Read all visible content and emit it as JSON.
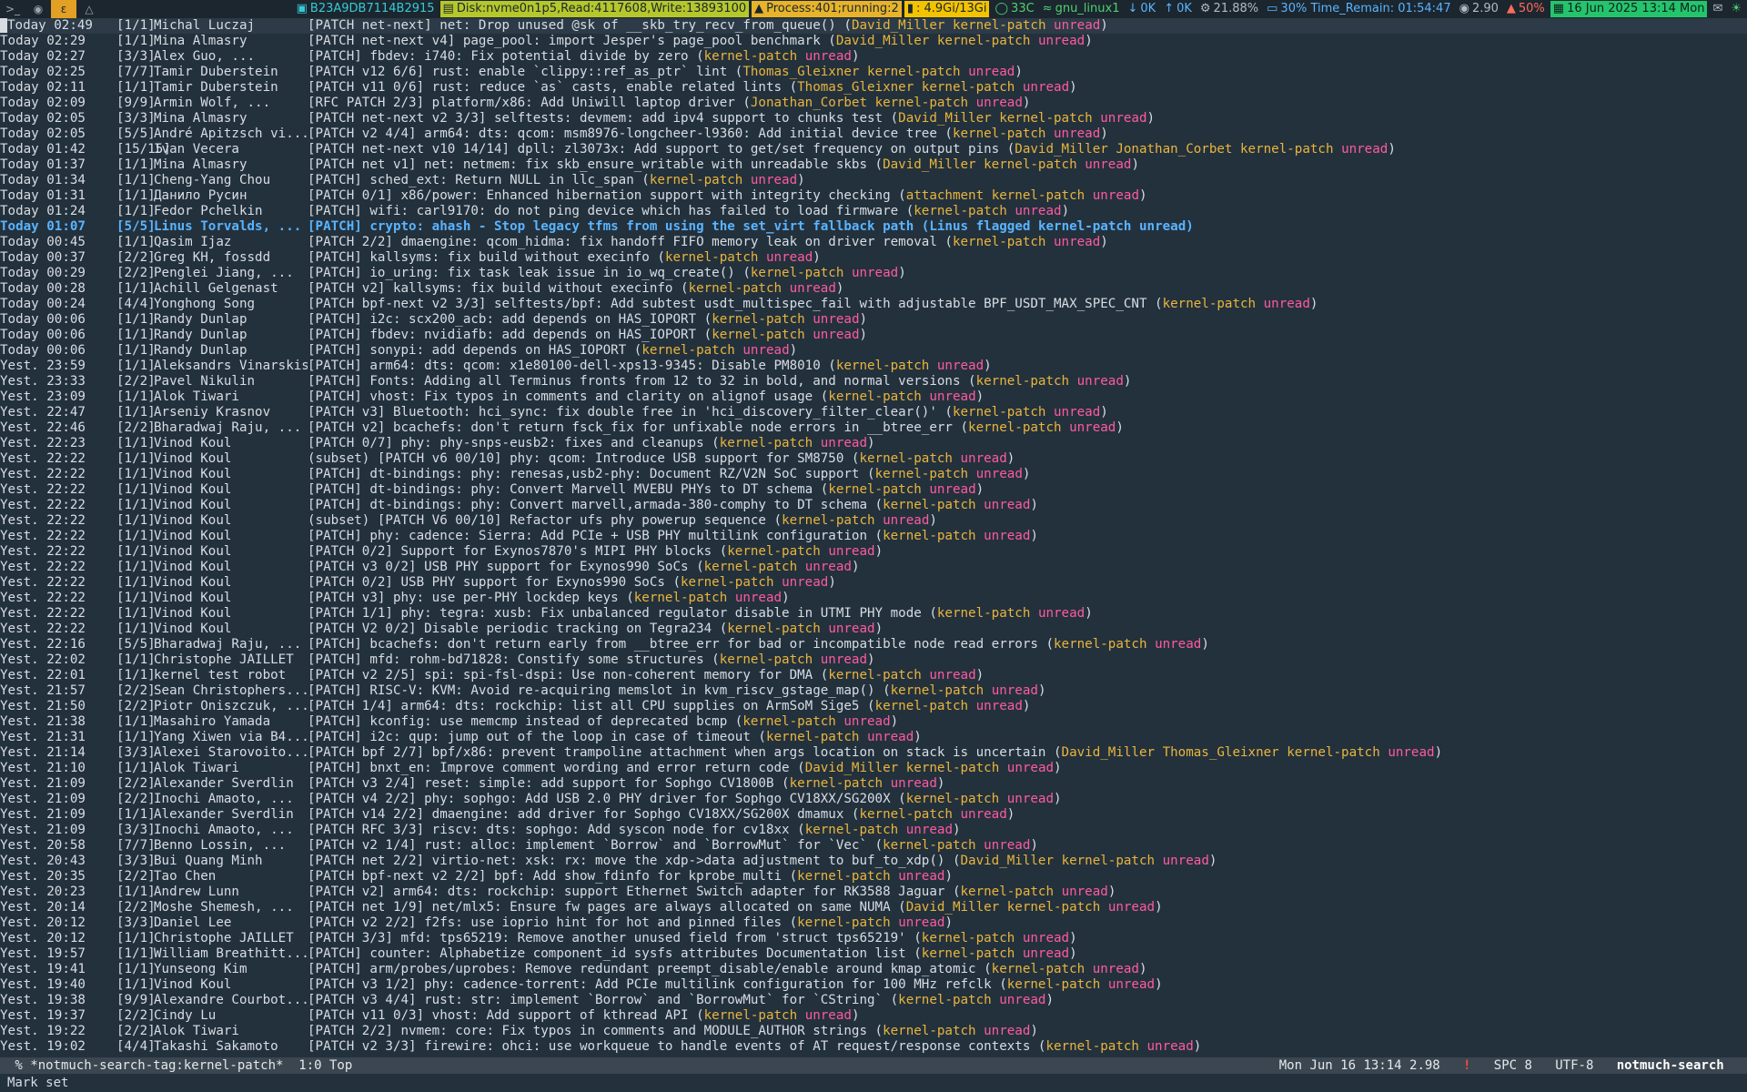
{
  "topbar": {
    "hostname": "B23A9DB7114B2915",
    "disk": "Disk:nvme0n1p5,Read:4117608,Write:13893100",
    "process": "Process:401;running:2",
    "mem": ": 4.9Gi/13Gi",
    "temp": "33C",
    "wifi": "gnu_linux1",
    "net_down": "0K",
    "net_up": "0K",
    "cpu": "21.88%",
    "battery": "30% Time_Remain: 01:54:47",
    "load": "2.90",
    "volume": "50%",
    "datetime": "16 Jun 2025 13:14 Mon"
  },
  "mail_list": [
    {
      "date": "Today 02:49",
      "count": "[1/1]",
      "author": "Michal Luczaj",
      "subject": "[PATCH net-next] net: Drop unused @sk of __skb_try_recv_from_queue()",
      "tags": [
        "David_Miller",
        "kernel-patch",
        "unread"
      ]
    },
    {
      "date": "Today 02:29",
      "count": "[1/1]",
      "author": "Mina Almasry",
      "subject": "[PATCH net-next v4] page_pool: import Jesper's page_pool benchmark",
      "tags": [
        "David_Miller",
        "kernel-patch",
        "unread"
      ]
    },
    {
      "date": "Today 02:27",
      "count": "[3/3]",
      "author": "Alex Guo, ...",
      "subject": "[PATCH] fbdev: i740: Fix potential divide by zero",
      "tags": [
        "kernel-patch",
        "unread"
      ]
    },
    {
      "date": "Today 02:25",
      "count": "[7/7]",
      "author": "Tamir Duberstein",
      "subject": "[PATCH v12 6/6] rust: enable `clippy::ref_as_ptr` lint",
      "tags": [
        "Thomas_Gleixner",
        "kernel-patch",
        "unread"
      ]
    },
    {
      "date": "Today 02:11",
      "count": "[1/1]",
      "author": "Tamir Duberstein",
      "subject": "[PATCH v11 0/6] rust: reduce `as` casts, enable related lints",
      "tags": [
        "Thomas_Gleixner",
        "kernel-patch",
        "unread"
      ]
    },
    {
      "date": "Today 02:09",
      "count": "[9/9]",
      "author": "Armin Wolf, ...",
      "subject": "[RFC PATCH 2/3] platform/x86: Add Uniwill laptop driver",
      "tags": [
        "Jonathan_Corbet",
        "kernel-patch",
        "unread"
      ]
    },
    {
      "date": "Today 02:05",
      "count": "[3/3]",
      "author": "Mina Almasry",
      "subject": "[PATCH net-next v2 3/3] selftests: devmem: add ipv4 support to chunks test",
      "tags": [
        "David_Miller",
        "kernel-patch",
        "unread"
      ]
    },
    {
      "date": "Today 02:05",
      "count": "[5/5]",
      "author": "André Apitzsch vi...",
      "subject": "[PATCH v2 4/4] arm64: dts: qcom: msm8976-longcheer-l9360: Add initial device tree",
      "tags": [
        "kernel-patch",
        "unread"
      ]
    },
    {
      "date": "Today 01:42",
      "count": "[15/15]",
      "author": "Ivan Vecera",
      "subject": "[PATCH net-next v10 14/14] dpll: zl3073x: Add support to get/set frequency on output pins",
      "tags": [
        "David_Miller",
        "Jonathan_Corbet",
        "kernel-patch",
        "unread"
      ]
    },
    {
      "date": "Today 01:37",
      "count": "[1/1]",
      "author": "Mina Almasry",
      "subject": "[PATCH net v1] net: netmem: fix skb_ensure_writable with unreadable skbs",
      "tags": [
        "David_Miller",
        "kernel-patch",
        "unread"
      ]
    },
    {
      "date": "Today 01:34",
      "count": "[1/1]",
      "author": "Cheng-Yang Chou",
      "subject": "[PATCH] sched_ext: Return NULL in llc_span",
      "tags": [
        "kernel-patch",
        "unread"
      ]
    },
    {
      "date": "Today 01:31",
      "count": "[1/1]",
      "author": "Данило Русин",
      "subject": "[PATCH 0/1] x86/power: Enhanced hibernation support with integrity checking",
      "tags": [
        "attachment",
        "kernel-patch",
        "unread"
      ]
    },
    {
      "date": "Today 01:24",
      "count": "[1/1]",
      "author": "Fedor Pchelkin",
      "subject": "[PATCH] wifi: carl9170: do not ping device which has failed to load firmware",
      "tags": [
        "kernel-patch",
        "unread"
      ]
    },
    {
      "date": "Today 01:07",
      "count": "[5/5]",
      "author": "Linus Torvalds, ...",
      "subject": "[PATCH] crypto: ahash - Stop legacy tfms from using the set_virt fallback path",
      "tags": [
        "Linus",
        "flagged",
        "kernel-patch",
        "unread"
      ],
      "highlight": true
    },
    {
      "date": "Today 00:45",
      "count": "[1/1]",
      "author": "Qasim Ijaz",
      "subject": "[PATCH 2/2] dmaengine: qcom_hidma: fix handoff FIFO memory leak on driver removal",
      "tags": [
        "kernel-patch",
        "unread"
      ]
    },
    {
      "date": "Today 00:37",
      "count": "[2/2]",
      "author": "Greg KH, fossdd",
      "subject": "[PATCH] kallsyms: fix build without execinfo",
      "tags": [
        "kernel-patch",
        "unread"
      ]
    },
    {
      "date": "Today 00:29",
      "count": "[2/2]",
      "author": "Penglei Jiang, ...",
      "subject": "[PATCH] io_uring: fix task leak issue in io_wq_create()",
      "tags": [
        "kernel-patch",
        "unread"
      ]
    },
    {
      "date": "Today 00:28",
      "count": "[1/1]",
      "author": "Achill Gelgenast",
      "subject": "[PATCH v2] kallsyms: fix build without execinfo",
      "tags": [
        "kernel-patch",
        "unread"
      ]
    },
    {
      "date": "Today 00:24",
      "count": "[4/4]",
      "author": "Yonghong Song",
      "subject": "[PATCH bpf-next v2 3/3] selftests/bpf: Add subtest usdt_multispec_fail with adjustable BPF_USDT_MAX_SPEC_CNT",
      "tags": [
        "kernel-patch",
        "unread"
      ]
    },
    {
      "date": "Today 00:06",
      "count": "[1/1]",
      "author": "Randy Dunlap",
      "subject": "[PATCH] i2c: scx200_acb: add depends on HAS_IOPORT",
      "tags": [
        "kernel-patch",
        "unread"
      ]
    },
    {
      "date": "Today 00:06",
      "count": "[1/1]",
      "author": "Randy Dunlap",
      "subject": "[PATCH] fbdev: nvidiafb: add depends on HAS_IOPORT",
      "tags": [
        "kernel-patch",
        "unread"
      ]
    },
    {
      "date": "Today 00:06",
      "count": "[1/1]",
      "author": "Randy Dunlap",
      "subject": "[PATCH] sonypi: add depends on HAS_IOPORT",
      "tags": [
        "kernel-patch",
        "unread"
      ]
    },
    {
      "date": "Yest. 23:59",
      "count": "[1/1]",
      "author": "Aleksandrs Vinarskis",
      "subject": "[PATCH] arm64: dts: qcom: x1e80100-dell-xps13-9345: Disable PM8010",
      "tags": [
        "kernel-patch",
        "unread"
      ]
    },
    {
      "date": "Yest. 23:33",
      "count": "[2/2]",
      "author": "Pavel Nikulin",
      "subject": "[PATCH] Fonts: Adding all Terminus fronts from 12 to 32 in bold, and normal versions",
      "tags": [
        "kernel-patch",
        "unread"
      ]
    },
    {
      "date": "Yest. 23:09",
      "count": "[1/1]",
      "author": "Alok Tiwari",
      "subject": "[PATCH] vhost: Fix typos in comments and clarity on alignof usage",
      "tags": [
        "kernel-patch",
        "unread"
      ]
    },
    {
      "date": "Yest. 22:47",
      "count": "[1/1]",
      "author": "Arseniy Krasnov",
      "subject": "[PATCH v3] Bluetooth: hci_sync: fix double free in 'hci_discovery_filter_clear()'",
      "tags": [
        "kernel-patch",
        "unread"
      ]
    },
    {
      "date": "Yest. 22:46",
      "count": "[2/2]",
      "author": "Bharadwaj Raju, ...",
      "subject": "[PATCH v2] bcachefs: don't return fsck_fix for unfixable node errors in __btree_err",
      "tags": [
        "kernel-patch",
        "unread"
      ]
    },
    {
      "date": "Yest. 22:23",
      "count": "[1/1]",
      "author": "Vinod Koul",
      "subject": "[PATCH 0/7] phy: phy-snps-eusb2: fixes and cleanups",
      "tags": [
        "kernel-patch",
        "unread"
      ]
    },
    {
      "date": "Yest. 22:22",
      "count": "[1/1]",
      "author": "Vinod Koul",
      "subject": "(subset) [PATCH v6 00/10] phy: qcom: Introduce USB support for SM8750",
      "tags": [
        "kernel-patch",
        "unread"
      ]
    },
    {
      "date": "Yest. 22:22",
      "count": "[1/1]",
      "author": "Vinod Koul",
      "subject": "[PATCH] dt-bindings: phy: renesas,usb2-phy: Document RZ/V2N SoC support",
      "tags": [
        "kernel-patch",
        "unread"
      ]
    },
    {
      "date": "Yest. 22:22",
      "count": "[1/1]",
      "author": "Vinod Koul",
      "subject": "[PATCH] dt-bindings: phy: Convert Marvell MVEBU PHYs to DT schema",
      "tags": [
        "kernel-patch",
        "unread"
      ]
    },
    {
      "date": "Yest. 22:22",
      "count": "[1/1]",
      "author": "Vinod Koul",
      "subject": "[PATCH] dt-bindings: phy: Convert marvell,armada-380-comphy to DT schema",
      "tags": [
        "kernel-patch",
        "unread"
      ]
    },
    {
      "date": "Yest. 22:22",
      "count": "[1/1]",
      "author": "Vinod Koul",
      "subject": "(subset) [PATCH V6 00/10] Refactor ufs phy powerup sequence",
      "tags": [
        "kernel-patch",
        "unread"
      ]
    },
    {
      "date": "Yest. 22:22",
      "count": "[1/1]",
      "author": "Vinod Koul",
      "subject": "[PATCH] phy: cadence: Sierra: Add PCIe + USB PHY multilink configuration",
      "tags": [
        "kernel-patch",
        "unread"
      ]
    },
    {
      "date": "Yest. 22:22",
      "count": "[1/1]",
      "author": "Vinod Koul",
      "subject": "[PATCH 0/2] Support for Exynos7870's MIPI PHY blocks",
      "tags": [
        "kernel-patch",
        "unread"
      ]
    },
    {
      "date": "Yest. 22:22",
      "count": "[1/1]",
      "author": "Vinod Koul",
      "subject": "[PATCH v3 0/2] USB PHY support for Exynos990 SoCs",
      "tags": [
        "kernel-patch",
        "unread"
      ]
    },
    {
      "date": "Yest. 22:22",
      "count": "[1/1]",
      "author": "Vinod Koul",
      "subject": "[PATCH 0/2] USB PHY support for Exynos990 SoCs",
      "tags": [
        "kernel-patch",
        "unread"
      ]
    },
    {
      "date": "Yest. 22:22",
      "count": "[1/1]",
      "author": "Vinod Koul",
      "subject": "[PATCH v3] phy: use per-PHY lockdep keys",
      "tags": [
        "kernel-patch",
        "unread"
      ]
    },
    {
      "date": "Yest. 22:22",
      "count": "[1/1]",
      "author": "Vinod Koul",
      "subject": "[PATCH 1/1] phy: tegra: xusb: Fix unbalanced regulator disable in UTMI PHY mode",
      "tags": [
        "kernel-patch",
        "unread"
      ]
    },
    {
      "date": "Yest. 22:22",
      "count": "[1/1]",
      "author": "Vinod Koul",
      "subject": "[PATCH V2 0/2] Disable periodic tracking on Tegra234",
      "tags": [
        "kernel-patch",
        "unread"
      ]
    },
    {
      "date": "Yest. 22:16",
      "count": "[5/5]",
      "author": "Bharadwaj Raju, ...",
      "subject": "[PATCH] bcachefs: don't return early from __btree_err for bad or incompatible node read errors",
      "tags": [
        "kernel-patch",
        "unread"
      ]
    },
    {
      "date": "Yest. 22:02",
      "count": "[1/1]",
      "author": "Christophe JAILLET",
      "subject": "[PATCH] mfd: rohm-bd71828: Constify some structures",
      "tags": [
        "kernel-patch",
        "unread"
      ]
    },
    {
      "date": "Yest. 22:01",
      "count": "[1/1]",
      "author": "kernel test robot",
      "subject": "[PATCH v2 2/5] spi: spi-fsl-dspi: Use non-coherent memory for DMA",
      "tags": [
        "kernel-patch",
        "unread"
      ]
    },
    {
      "date": "Yest. 21:57",
      "count": "[2/2]",
      "author": "Sean Christophers...",
      "subject": "[PATCH] RISC-V: KVM: Avoid re-acquiring memslot in kvm_riscv_gstage_map()",
      "tags": [
        "kernel-patch",
        "unread"
      ]
    },
    {
      "date": "Yest. 21:50",
      "count": "[2/2]",
      "author": "Piotr Oniszczuk, ...",
      "subject": "[PATCH 1/4] arm64: dts: rockchip: list all CPU supplies on ArmSoM Sige5",
      "tags": [
        "kernel-patch",
        "unread"
      ]
    },
    {
      "date": "Yest. 21:38",
      "count": "[1/1]",
      "author": "Masahiro Yamada",
      "subject": "[PATCH] kconfig: use memcmp instead of deprecated bcmp",
      "tags": [
        "kernel-patch",
        "unread"
      ]
    },
    {
      "date": "Yest. 21:31",
      "count": "[1/1]",
      "author": "Yang Xiwen via B4...",
      "subject": "[PATCH] i2c: qup: jump out of the loop in case of timeout",
      "tags": [
        "kernel-patch",
        "unread"
      ]
    },
    {
      "date": "Yest. 21:14",
      "count": "[3/3]",
      "author": "Alexei Starovoito...",
      "subject": "[PATCH bpf 2/7] bpf/x86: prevent trampoline attachment when args location on stack is uncertain",
      "tags": [
        "David_Miller",
        "Thomas_Gleixner",
        "kernel-patch",
        "unread"
      ]
    },
    {
      "date": "Yest. 21:10",
      "count": "[1/1]",
      "author": "Alok Tiwari",
      "subject": "[PATCH] bnxt_en: Improve comment wording and error return code",
      "tags": [
        "David_Miller",
        "kernel-patch",
        "unread"
      ]
    },
    {
      "date": "Yest. 21:09",
      "count": "[2/2]",
      "author": "Alexander Sverdlin",
      "subject": "[PATCH v3 2/4] reset: simple: add support for Sophgo CV1800B",
      "tags": [
        "kernel-patch",
        "unread"
      ]
    },
    {
      "date": "Yest. 21:09",
      "count": "[2/2]",
      "author": "Inochi Amaoto, ...",
      "subject": "[PATCH v4 2/2] phy: sophgo: Add USB 2.0 PHY driver for Sophgo CV18XX/SG200X",
      "tags": [
        "kernel-patch",
        "unread"
      ]
    },
    {
      "date": "Yest. 21:09",
      "count": "[1/1]",
      "author": "Alexander Sverdlin",
      "subject": "[PATCH v14 2/2] dmaengine: add driver for Sophgo CV18XX/SG200X dmamux",
      "tags": [
        "kernel-patch",
        "unread"
      ]
    },
    {
      "date": "Yest. 21:09",
      "count": "[3/3]",
      "author": "Inochi Amaoto, ...",
      "subject": "[PATCH RFC 3/3] riscv: dts: sophgo: Add syscon node for cv18xx",
      "tags": [
        "kernel-patch",
        "unread"
      ]
    },
    {
      "date": "Yest. 20:58",
      "count": "[7/7]",
      "author": "Benno Lossin, ...",
      "subject": "[PATCH v2 1/4] rust: alloc: implement `Borrow` and `BorrowMut` for `Vec`",
      "tags": [
        "kernel-patch",
        "unread"
      ]
    },
    {
      "date": "Yest. 20:43",
      "count": "[3/3]",
      "author": "Bui Quang Minh",
      "subject": "[PATCH net 2/2] virtio-net: xsk: rx: move the xdp->data adjustment to buf_to_xdp()",
      "tags": [
        "David_Miller",
        "kernel-patch",
        "unread"
      ]
    },
    {
      "date": "Yest. 20:35",
      "count": "[2/2]",
      "author": "Tao Chen",
      "subject": "[PATCH bpf-next v2 2/2] bpf: Add show_fdinfo for kprobe_multi",
      "tags": [
        "kernel-patch",
        "unread"
      ]
    },
    {
      "date": "Yest. 20:23",
      "count": "[1/1]",
      "author": "Andrew Lunn",
      "subject": "[PATCH v2] arm64: dts: rockchip: support Ethernet Switch adapter for RK3588 Jaguar",
      "tags": [
        "kernel-patch",
        "unread"
      ]
    },
    {
      "date": "Yest. 20:14",
      "count": "[2/2]",
      "author": "Moshe Shemesh, ...",
      "subject": "[PATCH net 1/9] net/mlx5: Ensure fw pages are always allocated on same NUMA",
      "tags": [
        "David_Miller",
        "kernel-patch",
        "unread"
      ]
    },
    {
      "date": "Yest. 20:12",
      "count": "[3/3]",
      "author": "Daniel Lee",
      "subject": "[PATCH v2 2/2] f2fs: use ioprio hint for hot and pinned files",
      "tags": [
        "kernel-patch",
        "unread"
      ]
    },
    {
      "date": "Yest. 20:12",
      "count": "[1/1]",
      "author": "Christophe JAILLET",
      "subject": "[PATCH 3/3] mfd: tps65219: Remove another unused field from 'struct tps65219'",
      "tags": [
        "kernel-patch",
        "unread"
      ]
    },
    {
      "date": "Yest. 19:57",
      "count": "[1/1]",
      "author": "William Breathitt...",
      "subject": "[PATCH] counter: Alphabetize component_id sysfs attributes Documentation list",
      "tags": [
        "kernel-patch",
        "unread"
      ]
    },
    {
      "date": "Yest. 19:41",
      "count": "[1/1]",
      "author": "Yunseong Kim",
      "subject": "[PATCH] arm/probes/uprobes: Remove redundant preempt_disable/enable around kmap_atomic",
      "tags": [
        "kernel-patch",
        "unread"
      ]
    },
    {
      "date": "Yest. 19:40",
      "count": "[1/1]",
      "author": "Vinod Koul",
      "subject": "[PATCH v3 1/2] phy: cadence-torrent: Add PCIe multilink configuration for 100 MHz refclk",
      "tags": [
        "kernel-patch",
        "unread"
      ]
    },
    {
      "date": "Yest. 19:38",
      "count": "[9/9]",
      "author": "Alexandre Courbot...",
      "subject": "[PATCH v3 4/4] rust: str: implement `Borrow` and `BorrowMut` for `CString`",
      "tags": [
        "kernel-patch",
        "unread"
      ]
    },
    {
      "date": "Yest. 19:37",
      "count": "[2/2]",
      "author": "Cindy Lu",
      "subject": "[PATCH v11 0/3] vhost: Add support of kthread API",
      "tags": [
        "kernel-patch",
        "unread"
      ]
    },
    {
      "date": "Yest. 19:22",
      "count": "[2/2]",
      "author": "Alok Tiwari",
      "subject": "[PATCH 2/2] nvmem: core: Fix typos in comments and MODULE_AUTHOR strings",
      "tags": [
        "kernel-patch",
        "unread"
      ]
    },
    {
      "date": "Yest. 19:02",
      "count": "[4/4]",
      "author": "Takashi Sakamoto",
      "subject": "[PATCH v2 3/3] firewire: ohci: use workqueue to handle events of AT request/response contexts",
      "tags": [
        "kernel-patch",
        "unread"
      ]
    }
  ],
  "modeline": {
    "buffer": " % *notmuch-search-tag:kernel-patch*  1:0 Top",
    "datetime": "Mon Jun 16 13:14 2.98",
    "bang": "!",
    "spc": "SPC 8",
    "encoding": "UTF-8",
    "mode": "notmuch-search"
  },
  "minibuffer": "Mark set",
  "colors": {
    "background": "#23313d",
    "tag_name": "#e9b53c",
    "tag_unread": "#ff5aa0",
    "highlight": "#5ab4ff"
  }
}
